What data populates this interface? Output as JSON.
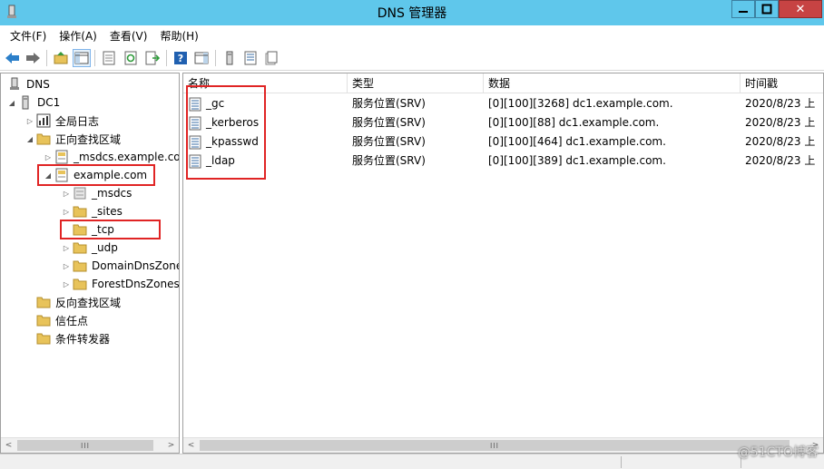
{
  "window": {
    "title": "DNS 管理器",
    "controls": {
      "minimize": "—",
      "maximize": "□",
      "close": "✕"
    }
  },
  "menu": {
    "items": [
      {
        "label": "文件(F)"
      },
      {
        "label": "操作(A)"
      },
      {
        "label": "查看(V)"
      },
      {
        "label": "帮助(H)"
      }
    ]
  },
  "toolbar": {
    "buttons": [
      "back-icon",
      "forward-icon",
      "up-folder-icon",
      "show-console-tree-icon",
      "properties-icon",
      "refresh-icon",
      "export-list-icon",
      "help-icon",
      "show-action-pane-icon",
      "server-icon",
      "zone-icon",
      "record-icon"
    ]
  },
  "tree": {
    "root": "DNS",
    "server": "DC1",
    "global_logs": "全局日志",
    "forward_zones": "正向查找区域",
    "msdcs_zone": "_msdcs.example.co",
    "example_zone": "example.com",
    "children": {
      "msdcs": "_msdcs",
      "sites": "_sites",
      "tcp": "_tcp",
      "udp": "_udp",
      "domain_dns_zones": "DomainDnsZone",
      "forest_dns_zones": "ForestDnsZones"
    },
    "reverse_zones": "反向查找区域",
    "trust_points": "信任点",
    "conditional_forwarders": "条件转发器"
  },
  "list": {
    "columns": [
      "名称",
      "类型",
      "数据",
      "时间戳"
    ],
    "rows": [
      {
        "name": "_gc",
        "type": "服务位置(SRV)",
        "data": "[0][100][3268] dc1.example.com.",
        "timestamp": "2020/8/23 上"
      },
      {
        "name": "_kerberos",
        "type": "服务位置(SRV)",
        "data": "[0][100][88] dc1.example.com.",
        "timestamp": "2020/8/23 上"
      },
      {
        "name": "_kpasswd",
        "type": "服务位置(SRV)",
        "data": "[0][100][464] dc1.example.com.",
        "timestamp": "2020/8/23 上"
      },
      {
        "name": "_ldap",
        "type": "服务位置(SRV)",
        "data": "[0][100][389] dc1.example.com.",
        "timestamp": "2020/8/23 上"
      }
    ]
  },
  "scrollbar": {
    "left_arrow": "<",
    "right_arrow": ">",
    "grip": "III"
  },
  "watermark": "@51CTO博客",
  "colors": {
    "titlebar": "#5fc7eb",
    "close_button": "#c74343",
    "highlight": "#e02424",
    "folder": "#e8c35a"
  }
}
